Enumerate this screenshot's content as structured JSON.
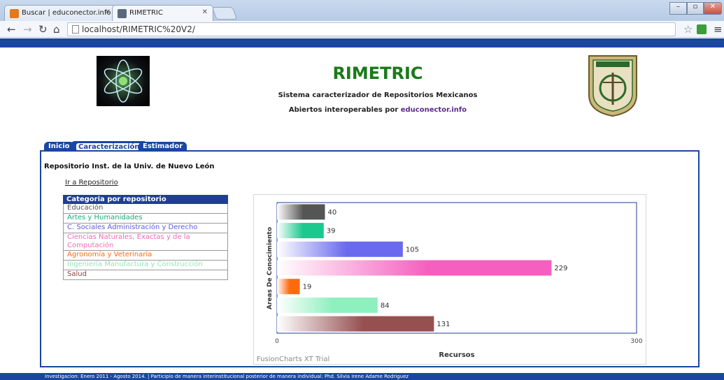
{
  "browser": {
    "tabs": [
      {
        "label": "Buscar | educonector.info",
        "favicon_color": "#e07a1f"
      },
      {
        "label": "RIMETRIC",
        "favicon_color": "#5a6a7a"
      }
    ],
    "url": "localhost/RIMETRIC%20V2/"
  },
  "header": {
    "title": "RIMETRIC",
    "subtitle_line1": "Sistema caracterizador de Repositorios Mexicanos",
    "subtitle_line2_prefix": "Abiertos interoperables por",
    "subtitle_line2_link": "educonector.info"
  },
  "nav": {
    "tabs": [
      "Inicio",
      "Caracterización",
      "Estimador"
    ]
  },
  "repo": {
    "name": "Repositorio Inst. de la Univ. de Nuevo León",
    "link_label": "Ir a Repositorio"
  },
  "categories": {
    "header": "Categoria por repositorio",
    "items": [
      {
        "label": "Educación",
        "color": "#555555"
      },
      {
        "label": "Artes y Humanidades",
        "color": "#1aab7a"
      },
      {
        "label": "C. Sociales Administración y Derecho",
        "color": "#5b5bd6"
      },
      {
        "label": "Ciencias Naturales, Exactas y de la Computación",
        "color": "#f06ab5"
      },
      {
        "label": "Agronomía y Veterinaria",
        "color": "#ff6a10"
      },
      {
        "label": "Ingeniería Manufactura y Construcción",
        "color": "#8fe8b8"
      },
      {
        "label": "Salud",
        "color": "#8a4040"
      }
    ]
  },
  "chart_data": {
    "type": "bar",
    "orientation": "horizontal",
    "categories": [
      "Educación",
      "Artes y Humanidades",
      "C. Sociales Administración y Derecho",
      "Ciencias Naturales, Exactas y de la Computación",
      "Agronomía y Veterinaria",
      "Ingeniería Manufactura y Construcción",
      "Salud"
    ],
    "values": [
      40,
      39,
      105,
      229,
      19,
      84,
      131
    ],
    "colors": [
      "#555555",
      "#1ac98d",
      "#6a6aee",
      "#f55fbf",
      "#ff6a10",
      "#8ff0bf",
      "#965050"
    ],
    "xlabel": "Recursos",
    "ylabel": "Areas De Conocimiento",
    "xlim": [
      0,
      300
    ],
    "xticks": [
      "0",
      "300"
    ],
    "watermark": "FusionCharts XT Trial"
  },
  "footer": {
    "text": "Investigacion: Enero 2011 - Agosto 2014. | Participio de manera interinstitucional posterior de manera individual: Phd. Silvia Irene Adame Rodriguez"
  }
}
